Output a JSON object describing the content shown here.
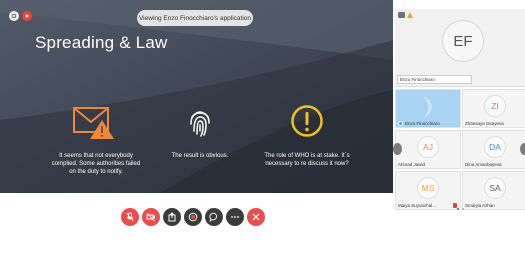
{
  "share": {
    "viewing_label": "Viewing Enzo Finocchiaro's application",
    "slide_title": "Spreading & Law",
    "columns": [
      {
        "icon": "envelope-warning-icon",
        "caption": "It seems that not everybody complied. Some authorities failed on the duty to notify."
      },
      {
        "icon": "fingerprint-icon",
        "caption": "The result is obvious."
      },
      {
        "icon": "exclamation-circle-icon",
        "caption": "The role of WHO is at stake. It´s necessary to re discuss it now?"
      }
    ],
    "accent_orange": "#f0883a",
    "accent_yellow": "#f2c21c"
  },
  "panel": {
    "presenter": {
      "initials": "EF",
      "name": "Enzo Finocchiaro"
    },
    "tiles": [
      {
        "initials": "",
        "name": "Enzo Finocchiaro",
        "active": true,
        "color": "#a9d3f2",
        "status": "online"
      },
      {
        "initials": "ZI",
        "name": "Zhansaya Issayeva",
        "active": false,
        "color": "#e46f6f"
      },
      {
        "initials": "AJ",
        "name": "Ahmad Jawid",
        "active": false,
        "color": "#ee8b5e"
      },
      {
        "initials": "DA",
        "name": "Dina Amanbayeva",
        "active": false,
        "color": "#3f93dc"
      },
      {
        "initials": "MS",
        "name": "Maiya Suyunchal...",
        "active": false,
        "color": "#f0a72c",
        "muted": true
      },
      {
        "initials": "SA",
        "name": "Smaiyla Azhan",
        "active": false,
        "color": "#666666"
      }
    ]
  },
  "toolbar": {
    "buttons": [
      {
        "name": "mute-mic-button",
        "icon": "mic-off-icon",
        "style": "red"
      },
      {
        "name": "stop-video-button",
        "icon": "video-off-icon",
        "style": "red"
      },
      {
        "name": "share-button",
        "icon": "share-icon",
        "style": "dark"
      },
      {
        "name": "record-button",
        "icon": "record-icon",
        "style": "dark"
      },
      {
        "name": "chat-button",
        "icon": "chat-icon",
        "style": "dark"
      },
      {
        "name": "more-button",
        "icon": "more-icon",
        "style": "dark"
      },
      {
        "name": "leave-button",
        "icon": "close-icon",
        "style": "red"
      }
    ]
  }
}
